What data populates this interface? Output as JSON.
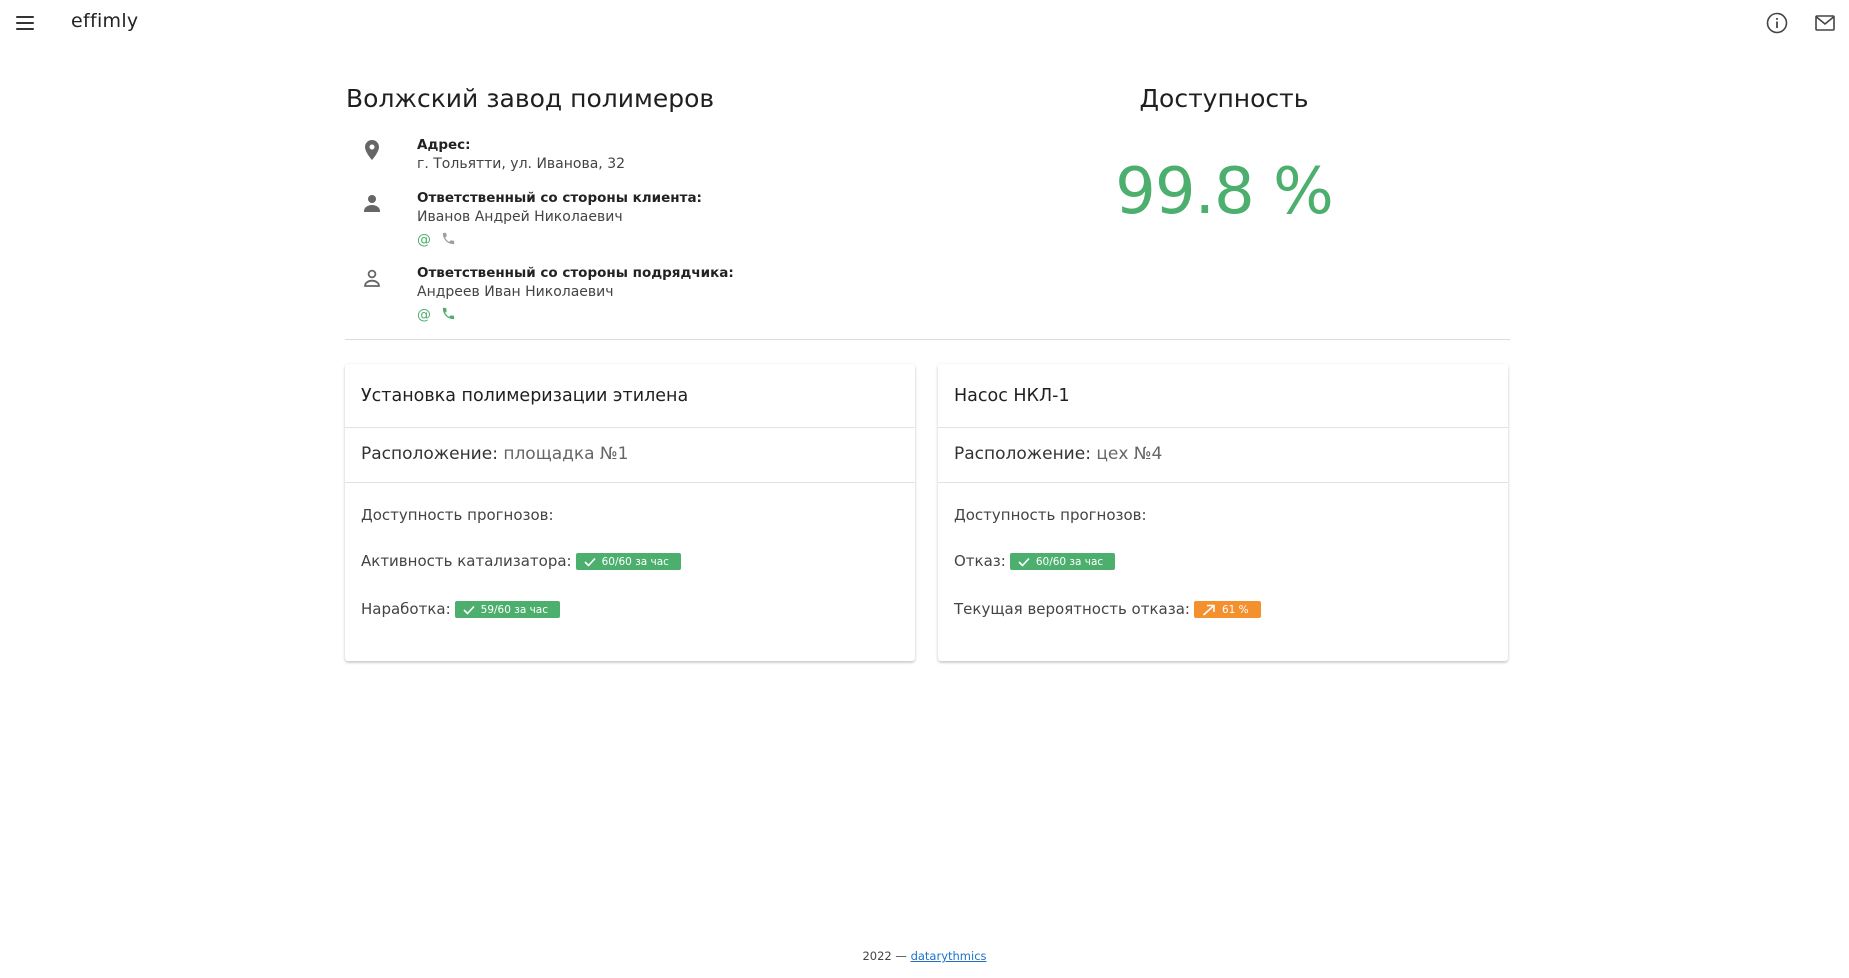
{
  "app": {
    "brand": "effimly"
  },
  "header": {
    "icons": {
      "menu": "menu-icon",
      "info": "info-icon",
      "mail": "mail-icon"
    }
  },
  "site": {
    "title": "Волжский завод полимеров",
    "address": {
      "label": "Адрес:",
      "value": "г. Тольятти, ул. Иванова, 32",
      "icon": "location-pin-icon"
    },
    "client_contact": {
      "label": "Ответственный со стороны клиента:",
      "value": "Иванов Андрей Николаевич",
      "icon": "person-icon"
    },
    "contractor_contact": {
      "label": "Ответственный со стороны подрядчика:",
      "value": "Андреев Иван Николаевич",
      "icon": "person-outline-icon"
    }
  },
  "availability": {
    "title": "Доступность",
    "value": "99.8 %"
  },
  "cards": [
    {
      "title": "Установка полимеризации этилена",
      "location_label": "Расположение:",
      "location_value": "площадка №1",
      "forecast_heading": "Доступность прогнозов:",
      "forecasts": [
        {
          "label": "Активность катализатора:",
          "badge": "60/60 за час",
          "status": "ok"
        },
        {
          "label": "Наработка:",
          "badge": "59/60 за час",
          "status": "ok"
        }
      ]
    },
    {
      "title": "Насос НКЛ-1",
      "location_label": "Расположение:",
      "location_value": "цех №4",
      "forecast_heading": "Доступность прогнозов:",
      "forecasts": [
        {
          "label": "Отказ:",
          "badge": "60/60 за час",
          "status": "ok"
        },
        {
          "label": "Текущая вероятность отказа:",
          "badge": "61 %",
          "status": "warning"
        }
      ]
    }
  ],
  "footer": {
    "text": "2022 —",
    "link": "datarythmics"
  },
  "colors": {
    "green": "#4caf6e",
    "orange": "#f5902e",
    "link": "#1e73c8",
    "contact_active": "#4caf6e",
    "contact_inactive": "#9e9e9e"
  }
}
